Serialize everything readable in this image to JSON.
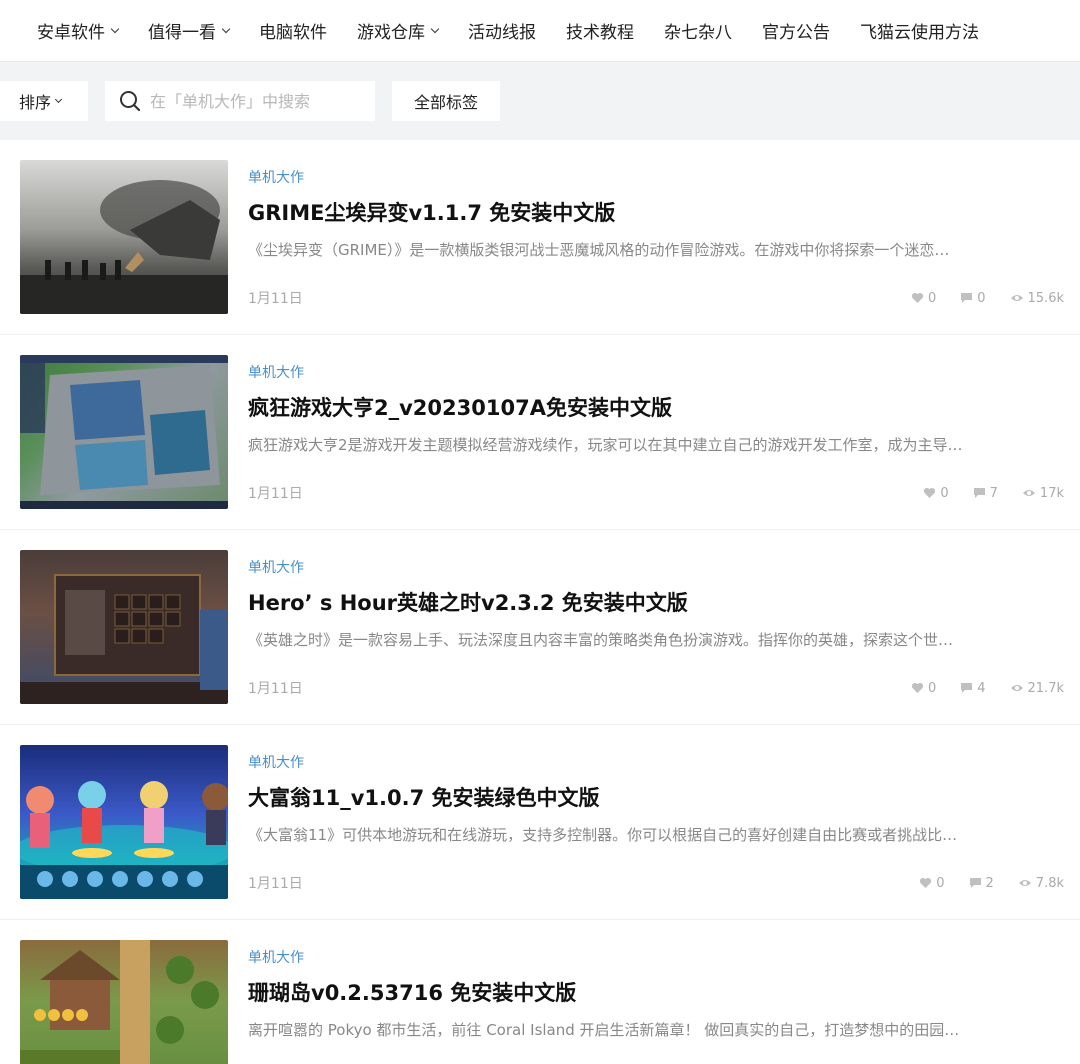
{
  "nav": {
    "items": [
      {
        "label": "安卓软件",
        "dropdown": true
      },
      {
        "label": "值得一看",
        "dropdown": true
      },
      {
        "label": "电脑软件",
        "dropdown": false
      },
      {
        "label": "游戏仓库",
        "dropdown": true
      },
      {
        "label": "活动线报",
        "dropdown": false
      },
      {
        "label": "技术教程",
        "dropdown": false
      },
      {
        "label": "杂七杂八",
        "dropdown": false
      },
      {
        "label": "官方公告",
        "dropdown": false
      },
      {
        "label": "飞猫云使用方法",
        "dropdown": false
      }
    ]
  },
  "filter": {
    "sort_label": "排序",
    "search_placeholder": "在「单机大作」中搜索",
    "tags_label": "全部标签"
  },
  "posts": [
    {
      "category": "单机大作",
      "title": "GRIME尘埃异变v1.1.7 免安装中文版",
      "desc": "《尘埃异变（GRIME）》是一款横版类银河战士恶魔城风格的动作冒险游戏。在游戏中你将探索一个迷恋…",
      "date": "1月11日",
      "likes": "0",
      "comments": "0",
      "views": "15.6k"
    },
    {
      "category": "单机大作",
      "title": "疯狂游戏大亨2_v20230107A免安装中文版",
      "desc": "疯狂游戏大亨2是游戏开发主题模拟经营游戏续作，玩家可以在其中建立自己的游戏开发工作室，成为主导…",
      "date": "1月11日",
      "likes": "0",
      "comments": "7",
      "views": "17k"
    },
    {
      "category": "单机大作",
      "title": "Hero’ s Hour英雄之时v2.3.2 免安装中文版",
      "desc": "《英雄之时》是一款容易上手、玩法深度且内容丰富的策略类角色扮演游戏。指挥你的英雄，探索这个世…",
      "date": "1月11日",
      "likes": "0",
      "comments": "4",
      "views": "21.7k"
    },
    {
      "category": "单机大作",
      "title": "大富翁11_v1.0.7 免安装绿色中文版",
      "desc": "《大富翁11》可供本地游玩和在线游玩，支持多控制器。你可以根据自己的喜好创建自由比赛或者挑战比…",
      "date": "1月11日",
      "likes": "0",
      "comments": "2",
      "views": "7.8k"
    },
    {
      "category": "单机大作",
      "title": "珊瑚岛v0.2.53716 免安装中文版",
      "desc": "离开喧嚣的 Pokyo 都市生活，前往 Coral Island 开启生活新篇章！ 做回真实的自己，打造梦想中的田园…",
      "date": "",
      "likes": "",
      "comments": "",
      "views": ""
    }
  ]
}
